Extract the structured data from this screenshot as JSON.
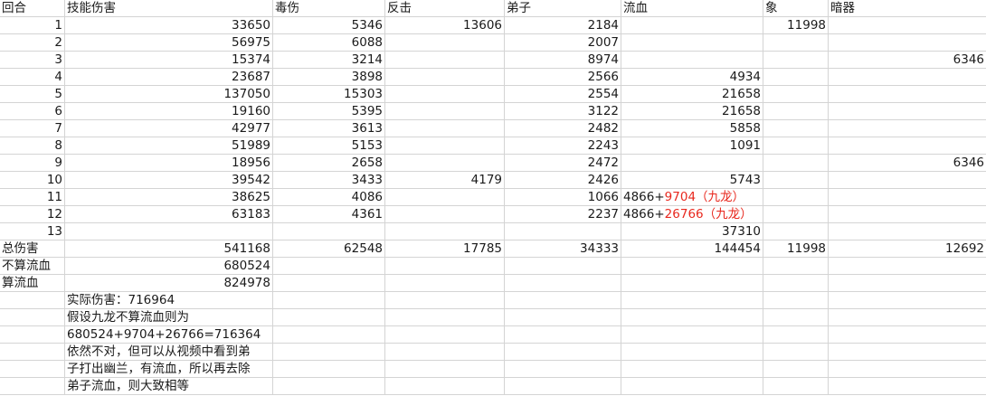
{
  "headers": [
    "回合",
    "技能伤害",
    "毒伤",
    "反击",
    "弟子",
    "流血",
    "象",
    "暗器"
  ],
  "rows": [
    {
      "round": "1",
      "skill": "33650",
      "poison": "5346",
      "counter": "13606",
      "disciple": "2184",
      "bleed": "",
      "xiang": "11998",
      "anqi": ""
    },
    {
      "round": "2",
      "skill": "56975",
      "poison": "6088",
      "counter": "",
      "disciple": "2007",
      "bleed": "",
      "xiang": "",
      "anqi": ""
    },
    {
      "round": "3",
      "skill": "15374",
      "poison": "3214",
      "counter": "",
      "disciple": "8974",
      "bleed": "",
      "xiang": "",
      "anqi": "6346"
    },
    {
      "round": "4",
      "skill": "23687",
      "poison": "3898",
      "counter": "",
      "disciple": "2566",
      "bleed": "4934",
      "xiang": "",
      "anqi": ""
    },
    {
      "round": "5",
      "skill": "137050",
      "poison": "15303",
      "counter": "",
      "disciple": "2554",
      "bleed": "21658",
      "xiang": "",
      "anqi": ""
    },
    {
      "round": "6",
      "skill": "19160",
      "poison": "5395",
      "counter": "",
      "disciple": "3122",
      "bleed": "21658",
      "xiang": "",
      "anqi": ""
    },
    {
      "round": "7",
      "skill": "42977",
      "poison": "3613",
      "counter": "",
      "disciple": "2482",
      "bleed": "5858",
      "xiang": "",
      "anqi": ""
    },
    {
      "round": "8",
      "skill": "51989",
      "poison": "5153",
      "counter": "",
      "disciple": "2243",
      "bleed": "1091",
      "xiang": "",
      "anqi": ""
    },
    {
      "round": "9",
      "skill": "18956",
      "poison": "2658",
      "counter": "",
      "disciple": "2472",
      "bleed": "",
      "xiang": "",
      "anqi": "6346"
    },
    {
      "round": "10",
      "skill": "39542",
      "poison": "3433",
      "counter": "4179",
      "disciple": "2426",
      "bleed": "5743",
      "xiang": "",
      "anqi": ""
    },
    {
      "round": "11",
      "skill": "38625",
      "poison": "4086",
      "counter": "",
      "disciple": "1066",
      "bleed": "",
      "xiang": "",
      "anqi": ""
    },
    {
      "round": "12",
      "skill": "63183",
      "poison": "4361",
      "counter": "",
      "disciple": "2237",
      "bleed": "",
      "xiang": "",
      "anqi": ""
    },
    {
      "round": "13",
      "skill": "",
      "poison": "",
      "counter": "",
      "disciple": "",
      "bleed": "37310",
      "xiang": "",
      "anqi": ""
    }
  ],
  "bleed_formula_11": {
    "base": "4866+",
    "red": "9704（九龙）"
  },
  "bleed_formula_12": {
    "base": "4866+",
    "red": "26766（九龙）"
  },
  "total_row": {
    "label": "总伤害",
    "skill": "541168",
    "poison": "62548",
    "counter": "17785",
    "disciple": "34333",
    "bleed": "144454",
    "xiang": "11998",
    "anqi": "12692"
  },
  "no_bleed_row": {
    "label": "不算流血",
    "value": "680524"
  },
  "with_bleed_row": {
    "label": "算流血",
    "value": "824978"
  },
  "notes": [
    "实际伤害：716964",
    "假设九龙不算流血则为",
    "680524+9704+26766=716364",
    "依然不对，但可以从视频中看到弟",
    "子打出幽兰，有流血，所以再去除",
    "弟子流血，则大致相等"
  ],
  "colors": {
    "grid": "#d4d4d4",
    "red_text": "#e8281e",
    "text": "#1a1a1a"
  }
}
